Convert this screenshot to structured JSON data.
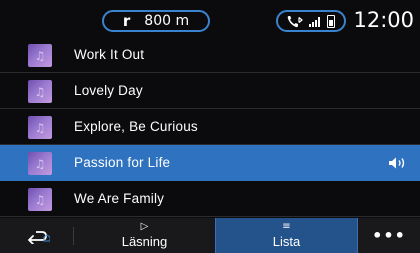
{
  "status_bar": {
    "navigation": {
      "turn_icon": "turn-right-icon",
      "turn_glyph": "r",
      "distance": "800 m"
    },
    "phone": {
      "icon": "phone-bluetooth-icon",
      "signal_icon": "signal-icon",
      "battery_icon": "battery-icon"
    },
    "clock": "12:00"
  },
  "track_list": [
    {
      "title": "Work It Out",
      "art_icon": "album-art-icon",
      "active": false
    },
    {
      "title": "Lovely Day",
      "art_icon": "album-art-icon",
      "active": false
    },
    {
      "title": "Explore, Be Curious",
      "art_icon": "album-art-icon",
      "active": false
    },
    {
      "title": "Passion for Life",
      "art_icon": "album-art-icon",
      "active": true,
      "status_icon": "speaker-playing-icon"
    },
    {
      "title": "We Are Family",
      "art_icon": "album-art-icon",
      "active": false
    }
  ],
  "bottom_bar": {
    "back": {
      "icon": "back-arrow-icon"
    },
    "tabs": [
      {
        "label": "Läsning",
        "icon": "play-icon",
        "glyph": "▷",
        "active": false
      },
      {
        "label": "Lista",
        "icon": "list-icon",
        "glyph": "≡",
        "active": true
      }
    ],
    "more": {
      "icon": "more-dots-icon",
      "glyph": "•••"
    }
  },
  "colors": {
    "active_row": "#2f72c0",
    "active_tab": "#24528a",
    "pill_border": "#3a84cf",
    "background": "#0b0b0d"
  }
}
